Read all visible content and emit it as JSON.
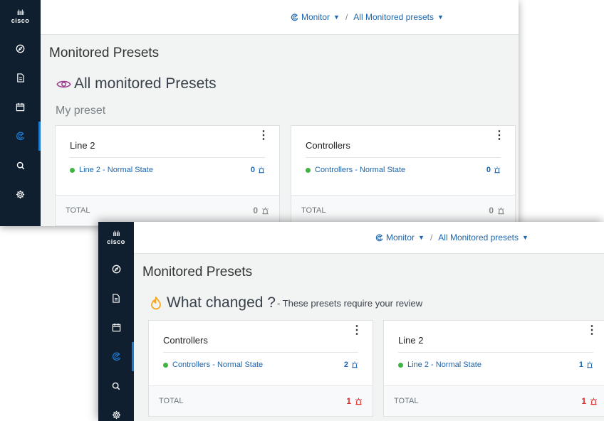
{
  "brand": {
    "logo_text": "cisco",
    "logo_bars": "ılıılı"
  },
  "icons": {
    "nav": [
      "compass-icon",
      "report-icon",
      "calendar-icon",
      "monitor-icon",
      "search-icon",
      "gear-icon"
    ],
    "alarm": "alarm-icon",
    "eye": "eye-icon",
    "flame": "flame-icon"
  },
  "colors": {
    "sidebar": "#0f1f2f",
    "link": "#1d65ae",
    "status_ok": "#3fb541",
    "alert": "#e12b2b",
    "active_accent": "#1d7bd1",
    "flame": "#f5a623",
    "eye": "#9b3b8f"
  },
  "screen1": {
    "breadcrumb": {
      "monitor": "Monitor",
      "presets": "All Monitored presets"
    },
    "page_title": "Monitored Presets",
    "section_title": "All monitored Presets",
    "group_title": "My preset",
    "cards": [
      {
        "name": "Line 2",
        "status_label": "Line 2 - Normal State",
        "status_count": "0",
        "total_label": "TOTAL",
        "total_count": "0"
      },
      {
        "name": "Controllers",
        "status_label": "Controllers - Normal State",
        "status_count": "0",
        "total_label": "TOTAL",
        "total_count": "0"
      }
    ]
  },
  "screen2": {
    "breadcrumb": {
      "monitor": "Monitor",
      "presets": "All Monitored presets"
    },
    "page_title": "Monitored Presets",
    "section_title": "What changed ?",
    "section_subtitle": "- These presets require your review",
    "cards": [
      {
        "name": "Controllers",
        "status_label": "Controllers - Normal State",
        "status_count": "2",
        "total_label": "TOTAL",
        "total_count": "1"
      },
      {
        "name": "Line 2",
        "status_label": "Line 2 - Normal State",
        "status_count": "1",
        "total_label": "TOTAL",
        "total_count": "1"
      }
    ]
  }
}
